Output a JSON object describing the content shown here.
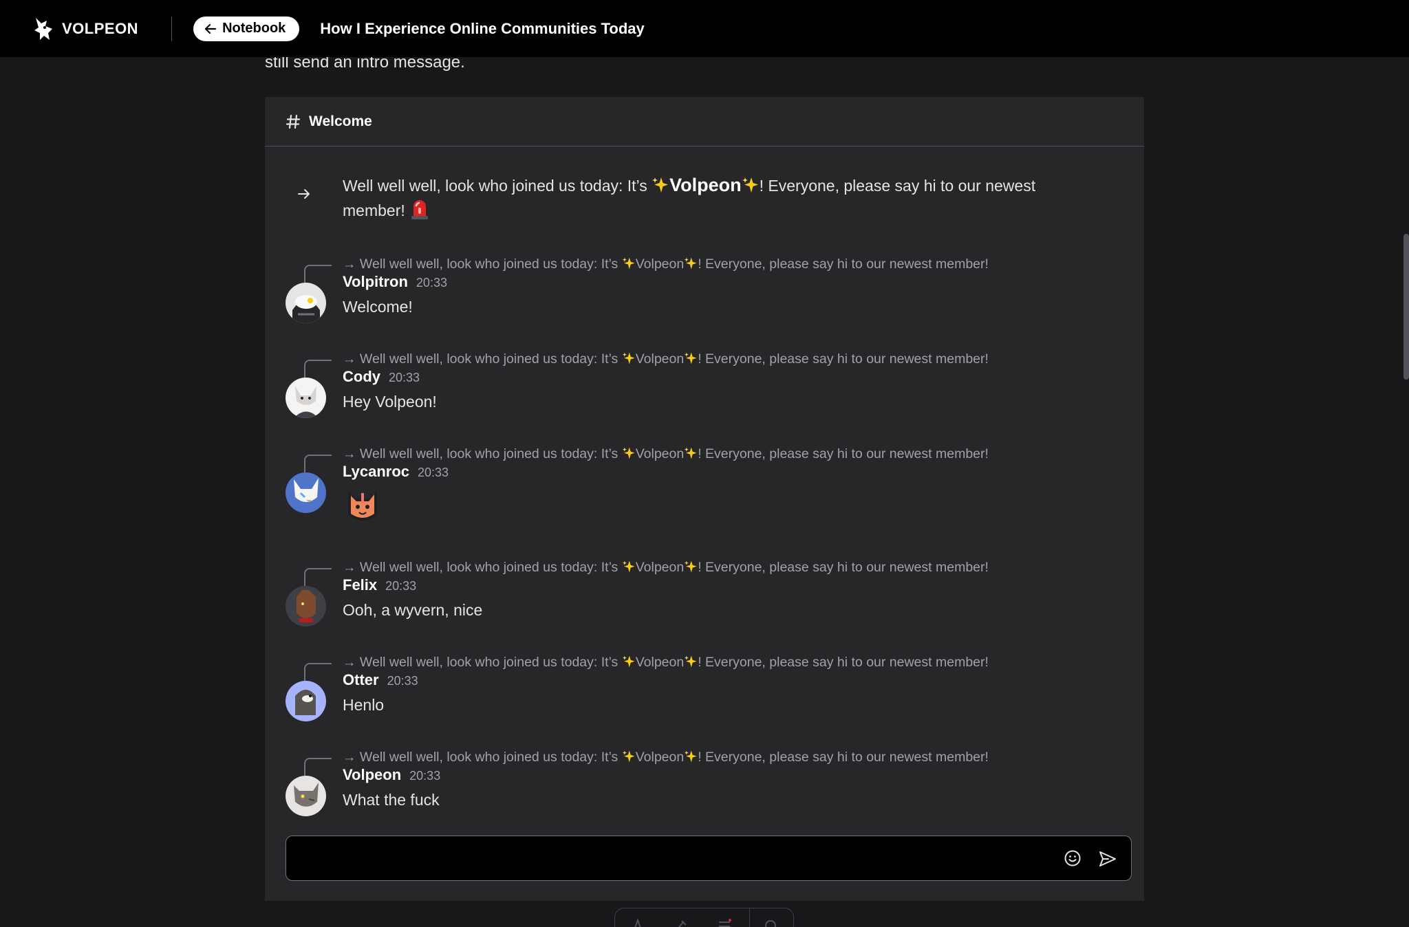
{
  "header": {
    "brand": "VOLPEON",
    "back_label": "Notebook",
    "title": "How I Experience Online Communities Today"
  },
  "article": {
    "intro_fragment": "still send an intro message."
  },
  "channel": {
    "name": "Welcome",
    "system_message": {
      "prefix": "Well well well, look who joined us today: It’s",
      "name": "Volpeon",
      "suffix": "! Everyone, please say hi to our newest",
      "tail": "member!"
    },
    "reply_quote": {
      "prefix": "→ Well well well, look who joined us today: It’s",
      "name": "Volpeon",
      "suffix": "! Everyone, please say hi to our newest member!"
    },
    "messages": [
      {
        "author": "Volpitron",
        "time": "20:33",
        "text": "Welcome!",
        "avatar": "robot-avatar"
      },
      {
        "author": "Cody",
        "time": "20:33",
        "text": "Hey Volpeon!",
        "avatar": "cat-avatar"
      },
      {
        "author": "Lycanroc",
        "time": "20:33",
        "text": "",
        "avatar": "wolf-avatar",
        "emoji": "fox-sticker"
      },
      {
        "author": "Felix",
        "time": "20:33",
        "text": "Ooh, a wyvern, nice",
        "avatar": "dragon-avatar"
      },
      {
        "author": "Otter",
        "time": "20:33",
        "text": "Henlo",
        "avatar": "otter-avatar"
      },
      {
        "author": "Volpeon",
        "time": "20:33",
        "text": "What the fuck",
        "avatar": "wyvern-avatar"
      }
    ]
  },
  "composer": {
    "value": "",
    "placeholder": ""
  },
  "colors": {
    "background": "#18181b",
    "panel": "#27272a",
    "topbar": "#000000",
    "muted_text": "#a1a1aa"
  }
}
